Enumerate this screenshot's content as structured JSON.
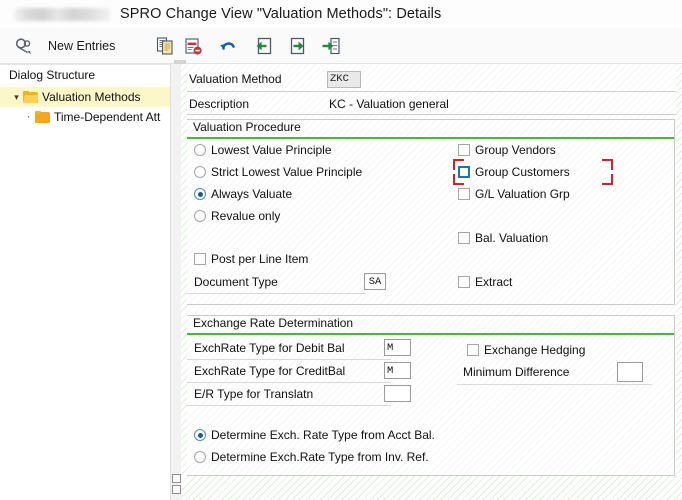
{
  "window": {
    "redacted_badge": "",
    "title": "SPRO Change View \"Valuation Methods\": Details"
  },
  "toolbar": {
    "display_change_icon": "display-change-icon",
    "new_entries_label": "New Entries",
    "copy_icon": "copy-icon",
    "delete_icon": "delete-icon",
    "undo_icon": "undo-icon",
    "previous_icon": "previous-entry-icon",
    "next_icon": "next-entry-icon",
    "variable_list_icon": "select-layout-icon"
  },
  "sidebar": {
    "header": "Dialog Structure",
    "items": [
      {
        "label": "Valuation Methods",
        "selected": true,
        "icon": "open-folder-icon"
      },
      {
        "label": "Time-Dependent Att",
        "selected": false,
        "icon": "folder-icon"
      }
    ]
  },
  "header_fields": {
    "valuation_method": {
      "label": "Valuation Method",
      "value": "ZKC"
    },
    "description": {
      "label": "Description",
      "value": "KC - Valuation general"
    }
  },
  "valuation_procedure": {
    "title": "Valuation Procedure",
    "radios": [
      {
        "label": "Lowest Value Principle",
        "selected": false
      },
      {
        "label": "Strict Lowest Value Principle",
        "selected": false
      },
      {
        "label": "Always Valuate",
        "selected": true
      },
      {
        "label": "Revalue only",
        "selected": false
      }
    ],
    "post_per_line_item": {
      "label": "Post per Line Item",
      "checked": false
    },
    "document_type": {
      "label": "Document Type",
      "value": "SA"
    },
    "checkboxes": [
      {
        "label": "Group Vendors",
        "checked": false,
        "focused": false
      },
      {
        "label": "Group Customers",
        "checked": false,
        "focused": true
      },
      {
        "label": "G/L Valuation Grp",
        "checked": false,
        "focused": false
      },
      {
        "label": "Bal. Valuation",
        "checked": false,
        "focused": false
      },
      {
        "label": "Extract",
        "checked": false,
        "focused": false
      }
    ]
  },
  "exchange_rate_determination": {
    "title": "Exchange Rate Determination",
    "fields": [
      {
        "label": "ExchRate Type for Debit Bal",
        "value": "M"
      },
      {
        "label": "ExchRate Type for CreditBal",
        "value": "M"
      },
      {
        "label": "E/R Type for Translatn",
        "value": ""
      }
    ],
    "exchange_hedging": {
      "label": "Exchange Hedging",
      "checked": false
    },
    "minimum_difference": {
      "label": "Minimum Difference",
      "value": ""
    },
    "determination_radios": [
      {
        "label": "Determine Exch. Rate Type from Acct Bal.",
        "selected": true
      },
      {
        "label": "Determine Exch.Rate Type from Inv. Ref.",
        "selected": false
      }
    ]
  },
  "colors": {
    "accent_green": "#3fbf2f",
    "selection_yellow": "#fbf7c8",
    "annotation_red": "#d91f27",
    "focus_blue": "#1a73b5"
  }
}
